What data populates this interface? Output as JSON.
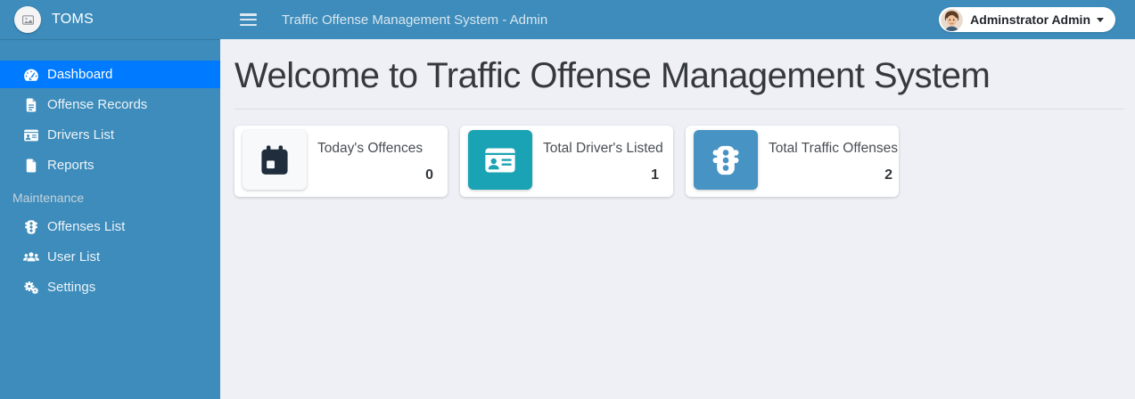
{
  "brand": {
    "name": "TOMS",
    "logo_icon": "broken-image-placeholder-icon"
  },
  "topbar": {
    "title": "Traffic Offense Management System - Admin",
    "menu_icon": "hamburger-icon",
    "user": {
      "name": "Adminstrator Admin",
      "avatar_icon": "user-avatar",
      "caret_icon": "caret-down-icon"
    }
  },
  "sidebar": {
    "items": [
      {
        "label": "Dashboard",
        "icon": "tachometer-icon",
        "active": true
      },
      {
        "label": "Offense Records",
        "icon": "file-alt-icon",
        "active": false
      },
      {
        "label": "Drivers List",
        "icon": "id-card-icon",
        "active": false
      },
      {
        "label": "Reports",
        "icon": "file-icon",
        "active": false
      }
    ],
    "section_header": "Maintenance",
    "maintenance_items": [
      {
        "label": "Offenses List",
        "icon": "traffic-light-icon"
      },
      {
        "label": "User List",
        "icon": "users-icon"
      },
      {
        "label": "Settings",
        "icon": "cogs-icon"
      }
    ]
  },
  "main": {
    "heading": "Welcome to Traffic Offense Management System",
    "cards": [
      {
        "title": "Today's Offences",
        "value": "0",
        "icon": "calendar-icon",
        "tile_bg": "#f8f9fa",
        "icon_color": "#1f2d3d"
      },
      {
        "title": "Total Driver's Listed",
        "value": "1",
        "icon": "id-card-icon",
        "tile_bg": "#1aa3b5",
        "icon_color": "#ffffff"
      },
      {
        "title": "Total Traffic Offenses",
        "value": "2",
        "icon": "traffic-light-icon",
        "tile_bg": "#4793c4",
        "icon_color": "#ffffff"
      }
    ]
  },
  "colors": {
    "chrome_blue": "#3d8cbb",
    "active_item_blue": "#007bff",
    "content_background": "#eef0f5",
    "card_background": "#ffffff"
  }
}
